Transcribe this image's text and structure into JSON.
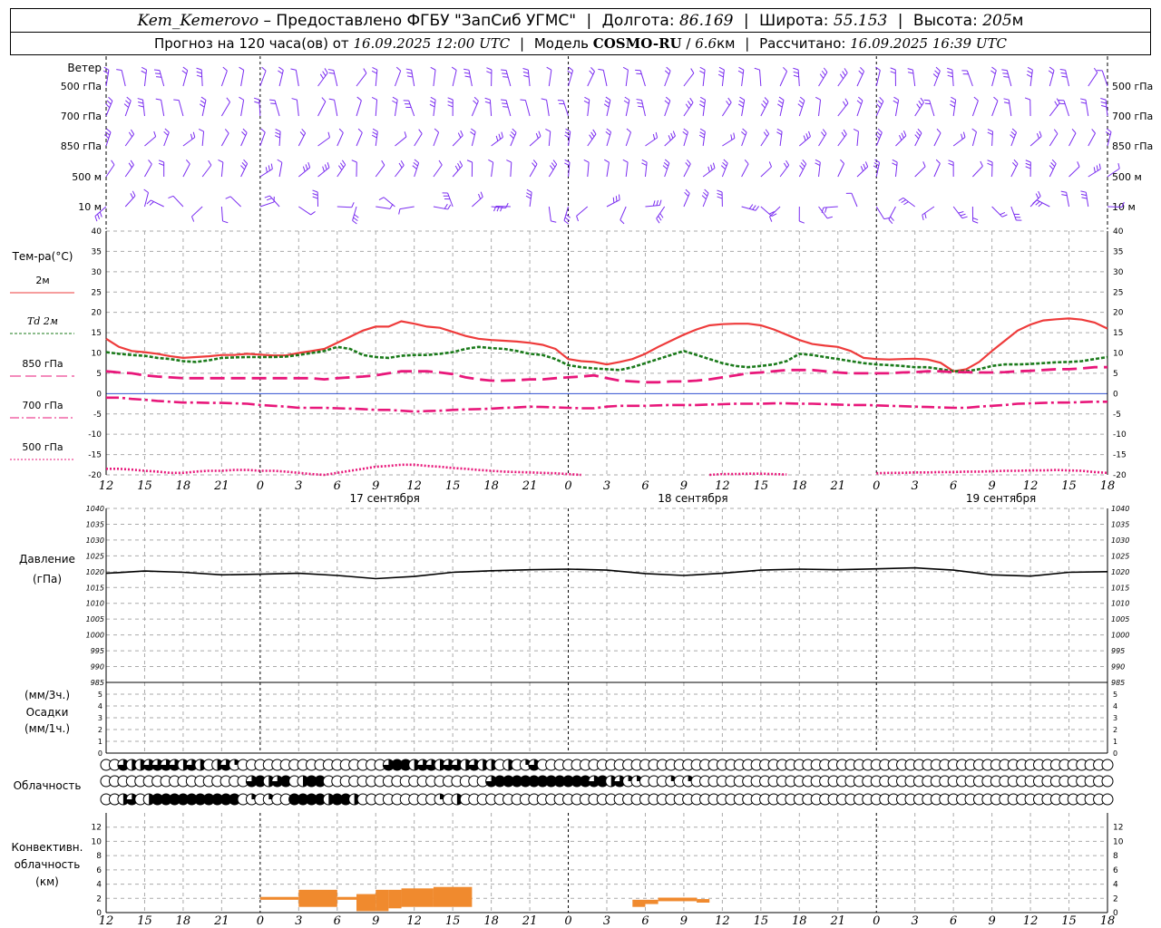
{
  "header": {
    "station": "Kem_Kemerovo",
    "dash": "–",
    "provided_by": "Предоставлено ФГБУ \"ЗапСиб УГМС\"",
    "lon_label": "Долгота:",
    "lon_value": "86.169",
    "lat_label": "Широта:",
    "lat_value": "55.153",
    "alt_label": "Высота:",
    "alt_value": "205",
    "alt_unit": "м",
    "forecast_label": "Прогноз на 120 часа(ов) от",
    "forecast_from": "16.09.2025 12:00 UTC",
    "model_label": "Модель",
    "model_name": "COSMO-RU",
    "model_res": "6.6",
    "model_res_unit": "км",
    "computed_label": "Рассчитано:",
    "computed_at": "16.09.2025 16:39 UTC"
  },
  "hour_ticks": [
    "12",
    "15",
    "18",
    "21",
    "0",
    "3",
    "6",
    "9",
    "12",
    "15",
    "18",
    "21",
    "0",
    "3",
    "6",
    "9",
    "12",
    "15",
    "18",
    "21",
    "0",
    "3",
    "6",
    "9",
    "12",
    "15",
    "18"
  ],
  "date_labels": [
    {
      "hour": 21,
      "text": "17 сентября"
    },
    {
      "hour": 45,
      "text": "18 сентября"
    },
    {
      "hour": 69,
      "text": "19 сентября"
    }
  ],
  "wind": {
    "title": "Ветер",
    "levels": [
      "500 гПа",
      "700 гПа",
      "850 гПа",
      "500 м",
      "10 м"
    ],
    "colors": {
      "barb": "#7a2cf0"
    }
  },
  "temperature": {
    "title": "Тем-ра(°C)",
    "ylim": [
      -20,
      40
    ],
    "ticks": [
      40,
      35,
      30,
      25,
      20,
      15,
      10,
      5,
      0,
      -5,
      -10,
      -15,
      -20
    ],
    "legend": [
      {
        "label": "2м",
        "color": "#ee3b3b"
      },
      {
        "label": "Td  2м",
        "color": "#1a7a1a"
      },
      {
        "label": "850 гПа",
        "color": "#e8177a"
      },
      {
        "label": "700 гПа",
        "color": "#e8177a"
      },
      {
        "label": "500 гПа",
        "color": "#e8177a"
      }
    ]
  },
  "pressure": {
    "title": "Давление",
    "unit": "(гПа)",
    "ylim": [
      985,
      1040
    ],
    "ticks": [
      1040,
      1035,
      1030,
      1025,
      1020,
      1015,
      1010,
      1005,
      1000,
      995,
      990,
      985
    ]
  },
  "precip": {
    "label_top": "(мм/3ч.)",
    "title": "Осадки",
    "label_bottom": "(мм/1ч.)",
    "ticks": [
      5,
      4,
      3,
      2,
      1,
      0
    ]
  },
  "clouds": {
    "title": "Облачность",
    "rows": [
      [
        0,
        0,
        3,
        2,
        2,
        3,
        3,
        3,
        3,
        2,
        3,
        2,
        0,
        2,
        3,
        1,
        0,
        0,
        0,
        0,
        0,
        0,
        0,
        0,
        0,
        0,
        0,
        0,
        0,
        0,
        0,
        0,
        0,
        3,
        4,
        4,
        2,
        3,
        3,
        2,
        3,
        3,
        2,
        3,
        2,
        2,
        0,
        2,
        0,
        1,
        3,
        0,
        0,
        0,
        0,
        0,
        0,
        0,
        0,
        0,
        0,
        0,
        0,
        0,
        0,
        0,
        0,
        0,
        0,
        0,
        0,
        0,
        0,
        0,
        0,
        0,
        0,
        0,
        0,
        0,
        0,
        0,
        0,
        0,
        0,
        0,
        0,
        0,
        0,
        0,
        0,
        0,
        0,
        0,
        0,
        0,
        0,
        0,
        0,
        0,
        0,
        0,
        0,
        0,
        0,
        0,
        0,
        0,
        0,
        0,
        0,
        0,
        0,
        0,
        0,
        0,
        0,
        0
      ],
      [
        0,
        0,
        0,
        0,
        0,
        0,
        0,
        0,
        0,
        0,
        0,
        0,
        0,
        0,
        0,
        0,
        0,
        3,
        4,
        2,
        3,
        4,
        0,
        2,
        4,
        4,
        0,
        0,
        0,
        0,
        0,
        0,
        0,
        0,
        0,
        0,
        0,
        0,
        0,
        0,
        0,
        0,
        0,
        0,
        0,
        3,
        4,
        4,
        4,
        4,
        4,
        4,
        4,
        4,
        4,
        4,
        4,
        3,
        4,
        2,
        3,
        1,
        1,
        0,
        0,
        0,
        1,
        0,
        1,
        0,
        0,
        0,
        0,
        0,
        0,
        0,
        0,
        0,
        0,
        0,
        0,
        0,
        0,
        0,
        0,
        0,
        0,
        0,
        0,
        0,
        0,
        0,
        0,
        0,
        0,
        0,
        0,
        0,
        0,
        0,
        0,
        0,
        0,
        0,
        0,
        0,
        0,
        0,
        0,
        0,
        0,
        0,
        0,
        0,
        0,
        0,
        0,
        0
      ],
      [
        0,
        0,
        2,
        3,
        0,
        2,
        4,
        4,
        4,
        4,
        4,
        4,
        4,
        4,
        4,
        4,
        0,
        1,
        0,
        1,
        0,
        0,
        4,
        4,
        4,
        4,
        2,
        4,
        4,
        2,
        0,
        0,
        0,
        0,
        0,
        0,
        0,
        0,
        0,
        1,
        0,
        2,
        0,
        0,
        0,
        0,
        0,
        0,
        0,
        0,
        0,
        0,
        0,
        0,
        0,
        0,
        0,
        0,
        0,
        0,
        0,
        0,
        0,
        0,
        0,
        0,
        0,
        0,
        0,
        0,
        0,
        0,
        0,
        0,
        0,
        0,
        0,
        0,
        0,
        0,
        0,
        0,
        0,
        0,
        0,
        0,
        0,
        0,
        0,
        0,
        0,
        0,
        0,
        0,
        0,
        0,
        0,
        0,
        0,
        0,
        0,
        0,
        0,
        0,
        0,
        0,
        0,
        0,
        0,
        0,
        0,
        0,
        0,
        0,
        0,
        0,
        0,
        0
      ]
    ]
  },
  "convective": {
    "title_1": "Конвективн.",
    "title_2": "облачность",
    "title_3": "(км)",
    "ylim": [
      0,
      14
    ],
    "ticks": [
      12,
      10,
      8,
      6,
      4,
      2,
      0
    ],
    "color": "#f08a2e",
    "bars": [
      {
        "h0": 12.0,
        "h1": 15.0,
        "base": 1.8,
        "top": 2.2
      },
      {
        "h0": 15.0,
        "h1": 18.0,
        "base": 0.8,
        "top": 3.2
      },
      {
        "h0": 18.0,
        "h1": 19.5,
        "base": 1.8,
        "top": 2.2
      },
      {
        "h0": 19.5,
        "h1": 21.0,
        "base": 0.2,
        "top": 2.6
      },
      {
        "h0": 21.0,
        "h1": 22.0,
        "base": 0.2,
        "top": 3.2
      },
      {
        "h0": 22.0,
        "h1": 23.0,
        "base": 0.6,
        "top": 3.2
      },
      {
        "h0": 23.0,
        "h1": 25.5,
        "base": 0.8,
        "top": 3.4
      },
      {
        "h0": 25.5,
        "h1": 28.5,
        "base": 0.8,
        "top": 3.6
      },
      {
        "h0": 41.0,
        "h1": 42.0,
        "base": 0.8,
        "top": 1.8
      },
      {
        "h0": 42.0,
        "h1": 43.0,
        "base": 1.2,
        "top": 1.8
      },
      {
        "h0": 43.0,
        "h1": 46.0,
        "base": 1.6,
        "top": 2.1
      },
      {
        "h0": 46.0,
        "h1": 47.0,
        "base": 1.4,
        "top": 1.9
      }
    ]
  },
  "chart_data": [
    {
      "type": "line",
      "title": "Тем-ра(°C)",
      "ylim": [
        -20,
        40
      ],
      "x_hours": [
        0,
        1,
        2,
        3,
        4,
        5,
        6,
        7,
        8,
        9,
        10,
        11,
        12,
        13,
        14,
        15,
        16,
        17,
        18,
        19,
        20,
        21,
        22,
        23,
        24,
        25,
        26,
        27,
        28,
        29,
        30,
        31,
        32,
        33,
        34,
        35,
        36,
        37,
        38,
        39,
        40,
        41,
        42,
        43,
        44,
        45,
        46,
        47,
        48,
        49,
        50,
        51,
        52,
        53,
        54,
        55,
        56,
        57,
        58,
        59,
        60,
        61,
        62,
        63,
        64,
        65,
        66,
        67,
        68,
        69,
        70,
        71,
        72,
        73,
        74,
        75,
        76,
        77,
        78
      ],
      "series": [
        {
          "name": "2м",
          "values": [
            13.5,
            11.5,
            10.5,
            10.2,
            9.8,
            9.2,
            8.8,
            9.0,
            9.2,
            9.5,
            9.5,
            9.8,
            9.6,
            9.4,
            9.4,
            10,
            10.5,
            11,
            12.5,
            14,
            15.5,
            16.5,
            16.5,
            17.8,
            17.2,
            16.5,
            16.2,
            15.2,
            14.2,
            13.5,
            13.2,
            13,
            12.8,
            12.5,
            12,
            11,
            8.5,
            8,
            7.8,
            7.2,
            7.8,
            8.5,
            9.8,
            11.5,
            13,
            14.5,
            15.8,
            16.8,
            17.1,
            17.2,
            17.2,
            16.8,
            15.8,
            14.5,
            13.2,
            12.2,
            11.8,
            11.5,
            10.5,
            8.8,
            8.5,
            8.4,
            8.5,
            8.6,
            8.4,
            7.6,
            5.5,
            6.0,
            7.8,
            10.5,
            13,
            15.5,
            17,
            18,
            18.3,
            18.5,
            18.2,
            17.5,
            16
          ]
        },
        {
          "name": "Td 2м",
          "values": [
            10.2,
            9.8,
            9.5,
            9.3,
            8.8,
            8.5,
            8.0,
            7.8,
            8.2,
            8.8,
            8.9,
            9.0,
            9.0,
            9.0,
            9.1,
            9.5,
            10.0,
            10.5,
            11.5,
            11.0,
            9.5,
            9.0,
            8.8,
            9.3,
            9.5,
            9.5,
            9.8,
            10.2,
            11,
            11.5,
            11.2,
            11,
            10.5,
            9.8,
            9.5,
            8.5,
            7,
            6.5,
            6.2,
            6.0,
            5.8,
            6.5,
            7.5,
            8.5,
            9.5,
            10.5,
            9.5,
            8.5,
            7.5,
            6.8,
            6.5,
            6.8,
            7.2,
            8.0,
            9.8,
            9.5,
            9.0,
            8.5,
            8.0,
            7.5,
            7.2,
            7.0,
            6.8,
            6.5,
            6.5,
            6.0,
            5.5,
            5.5,
            6.0,
            6.8,
            7.2,
            7.2,
            7.3,
            7.5,
            7.7,
            7.8,
            8.0,
            8.5,
            9.0
          ]
        },
        {
          "name": "850 гПа",
          "values": [
            5.5,
            5.2,
            5.0,
            4.5,
            4.2,
            4.0,
            3.8,
            3.8,
            3.8,
            3.8,
            3.8,
            3.8,
            3.8,
            3.8,
            3.8,
            3.8,
            3.8,
            3.5,
            3.8,
            4.0,
            4.2,
            4.5,
            5.0,
            5.5,
            5.5,
            5.5,
            5.2,
            4.8,
            4.0,
            3.5,
            3.2,
            3.2,
            3.3,
            3.5,
            3.5,
            3.8,
            4.0,
            4.2,
            4.5,
            3.8,
            3.2,
            3.0,
            2.8,
            2.8,
            3.0,
            3.0,
            3.2,
            3.5,
            4.0,
            4.5,
            5.0,
            5.2,
            5.5,
            5.8,
            5.8,
            5.8,
            5.5,
            5.2,
            5.0,
            5.0,
            5.0,
            5.0,
            5.2,
            5.3,
            5.5,
            5.5,
            5.3,
            5.3,
            5.2,
            5.2,
            5.3,
            5.5,
            5.6,
            5.8,
            6.0,
            6.0,
            6.2,
            6.5,
            6.5
          ]
        },
        {
          "name": "700 гПа",
          "values": [
            -1.0,
            -1.0,
            -1.3,
            -1.5,
            -1.8,
            -2.0,
            -2.2,
            -2.2,
            -2.3,
            -2.3,
            -2.4,
            -2.5,
            -2.8,
            -3.0,
            -3.2,
            -3.5,
            -3.5,
            -3.5,
            -3.6,
            -3.7,
            -3.8,
            -4.0,
            -4.0,
            -4.2,
            -4.4,
            -4.3,
            -4.2,
            -4.0,
            -3.9,
            -3.8,
            -3.7,
            -3.5,
            -3.4,
            -3.2,
            -3.3,
            -3.4,
            -3.5,
            -3.6,
            -3.6,
            -3.2,
            -3.0,
            -3.0,
            -3.0,
            -2.9,
            -2.8,
            -2.8,
            -2.8,
            -2.7,
            -2.6,
            -2.5,
            -2.5,
            -2.5,
            -2.4,
            -2.4,
            -2.5,
            -2.5,
            -2.6,
            -2.7,
            -2.8,
            -2.8,
            -2.9,
            -3.0,
            -3.1,
            -3.2,
            -3.3,
            -3.4,
            -3.5,
            -3.5,
            -3.2,
            -3.0,
            -2.8,
            -2.5,
            -2.4,
            -2.3,
            -2.2,
            -2.2,
            -2.1,
            -2.0,
            -2.0
          ]
        },
        {
          "name": "500 гПа",
          "values": [
            -18.5,
            -18.5,
            -18.7,
            -19.0,
            -19.2,
            -19.5,
            -19.5,
            -19.2,
            -19.0,
            -19.0,
            -18.8,
            -18.8,
            -19.0,
            -19.0,
            -19.2,
            -19.5,
            -19.8,
            -20,
            -19.5,
            -19.0,
            -18.5,
            -18.0,
            -17.8,
            -17.5,
            -17.5,
            -17.8,
            -18.0,
            -18.3,
            -18.5,
            -18.8,
            -19.0,
            -19.2,
            -19.3,
            -19.4,
            -19.5,
            -19.6,
            -19.8,
            -20,
            null,
            null,
            null,
            null,
            null,
            null,
            null,
            null,
            null,
            -20,
            -19.8,
            -19.8,
            -19.7,
            -19.7,
            -19.8,
            -19.9,
            null,
            null,
            null,
            null,
            null,
            null,
            -19.6,
            -19.5,
            -19.5,
            -19.4,
            -19.4,
            -19.3,
            -19.3,
            -19.2,
            -19.2,
            -19.1,
            -19.0,
            -19.0,
            -18.9,
            -18.9,
            -18.8,
            -18.9,
            -19.0,
            -19.3,
            -19.5
          ]
        }
      ]
    },
    {
      "type": "line",
      "title": "Давление",
      "ylim": [
        985,
        1040
      ],
      "x_hours": [
        0,
        3,
        6,
        9,
        12,
        15,
        18,
        21,
        24,
        27,
        30,
        33,
        36,
        39,
        42,
        45,
        48,
        51,
        54,
        57,
        60,
        63,
        66,
        69,
        72,
        75,
        78
      ],
      "series": [
        {
          "name": "Давление",
          "values": [
            1019.5,
            1020.2,
            1019.8,
            1019.0,
            1019.2,
            1019.5,
            1018.8,
            1017.8,
            1018.5,
            1019.8,
            1020.3,
            1020.6,
            1020.8,
            1020.5,
            1019.4,
            1018.8,
            1019.5,
            1020.5,
            1020.8,
            1020.6,
            1020.9,
            1021.2,
            1020.5,
            1019.0,
            1018.6,
            1019.8,
            1020.0
          ]
        }
      ]
    }
  ]
}
